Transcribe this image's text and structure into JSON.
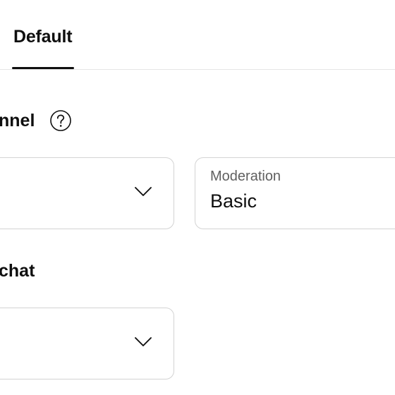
{
  "tabs": {
    "active": {
      "label": "Default"
    }
  },
  "sections": {
    "channel": {
      "title": "nnel",
      "help_icon": "help-circle-icon"
    },
    "chat": {
      "title": "chat"
    }
  },
  "fields": {
    "channel_select": {
      "value": "",
      "icon": "chevron-down-icon"
    },
    "moderation": {
      "label": "Moderation",
      "value": "Basic"
    },
    "chat_select": {
      "value": "",
      "icon": "chevron-down-icon"
    }
  },
  "colors": {
    "text": "#0f0f0f",
    "secondary_text": "#606060",
    "border": "#d3d3d3",
    "divider": "#e5e5e5"
  }
}
